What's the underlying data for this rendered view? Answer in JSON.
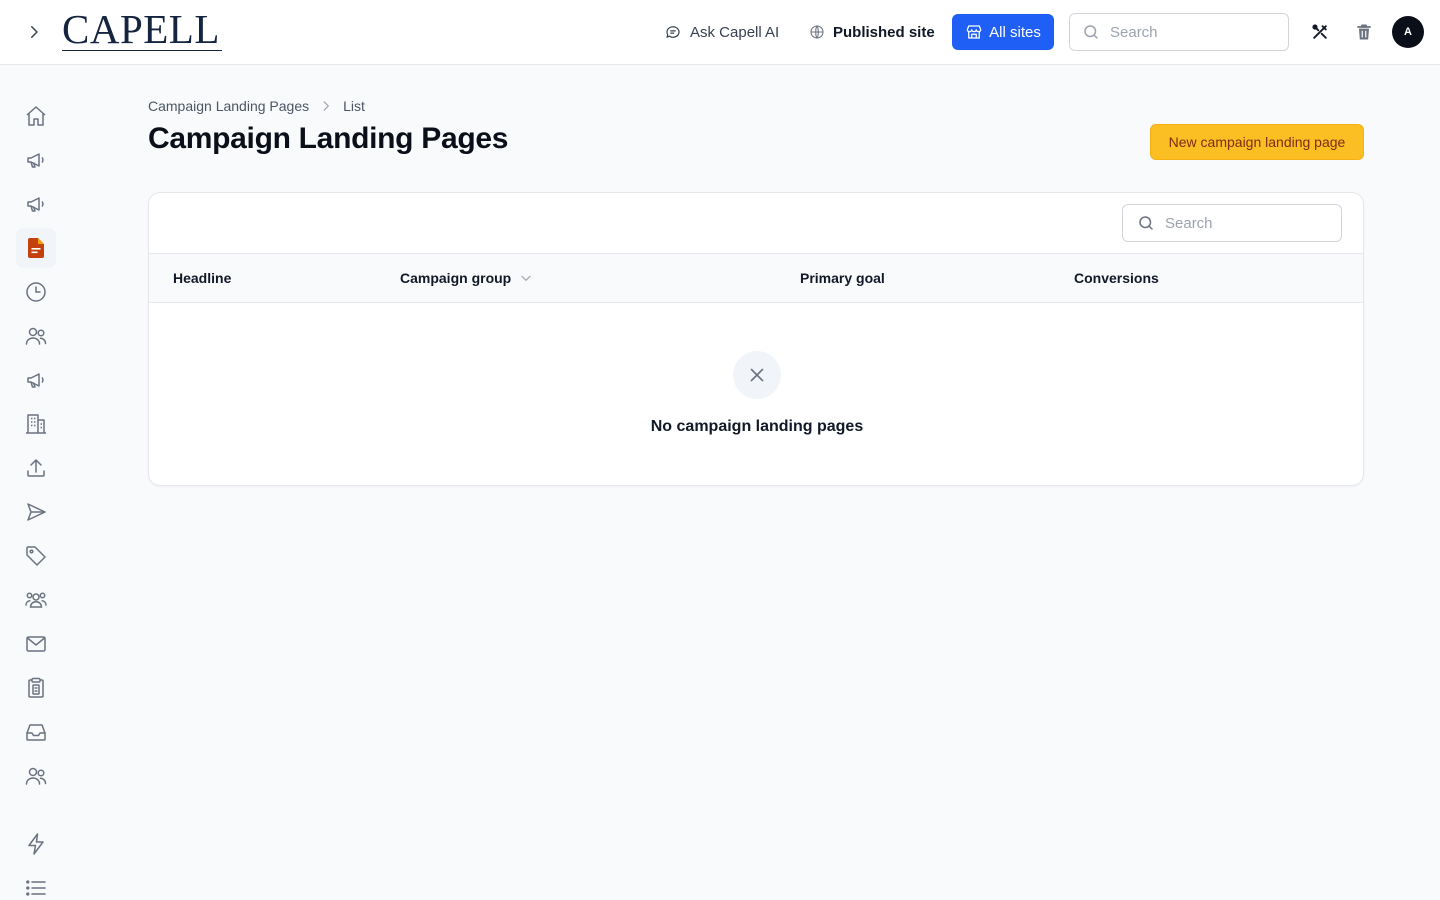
{
  "app": {
    "logo_text": "CAPELL"
  },
  "topbar": {
    "ask_ai_label": "Ask Capell AI",
    "published_site_label": "Published site",
    "all_sites_label": "All sites",
    "search_placeholder": "Search",
    "avatar_initial": "A",
    "accent_color": "#1f5ff5"
  },
  "sidebar": {
    "items": [
      {
        "icon": "home-icon"
      },
      {
        "icon": "megaphone-icon"
      },
      {
        "icon": "megaphone-icon"
      },
      {
        "icon": "document-icon",
        "active": true
      },
      {
        "icon": "clock-icon"
      },
      {
        "icon": "users-icon"
      },
      {
        "icon": "megaphone-icon"
      },
      {
        "icon": "building-icon"
      },
      {
        "icon": "upload-icon"
      },
      {
        "icon": "send-icon"
      },
      {
        "icon": "tag-icon"
      },
      {
        "icon": "user-group-icon"
      },
      {
        "icon": "mail-icon"
      },
      {
        "icon": "clipboard-icon"
      },
      {
        "icon": "inbox-icon"
      },
      {
        "icon": "users-icon"
      },
      {
        "icon": "bolt-icon"
      },
      {
        "icon": "list-icon"
      }
    ],
    "active_color": "#c2410c"
  },
  "breadcrumb": {
    "parent": "Campaign Landing Pages",
    "current": "List"
  },
  "page": {
    "title": "Campaign Landing Pages",
    "new_button_label": "New campaign landing page",
    "new_button_color": "#fbbf24"
  },
  "table": {
    "search_placeholder": "Search",
    "columns": [
      {
        "label": "Headline"
      },
      {
        "label": "Campaign group",
        "sortable": true
      },
      {
        "label": "Primary goal"
      },
      {
        "label": "Conversions"
      }
    ],
    "rows": [],
    "empty_message": "No campaign landing pages"
  }
}
